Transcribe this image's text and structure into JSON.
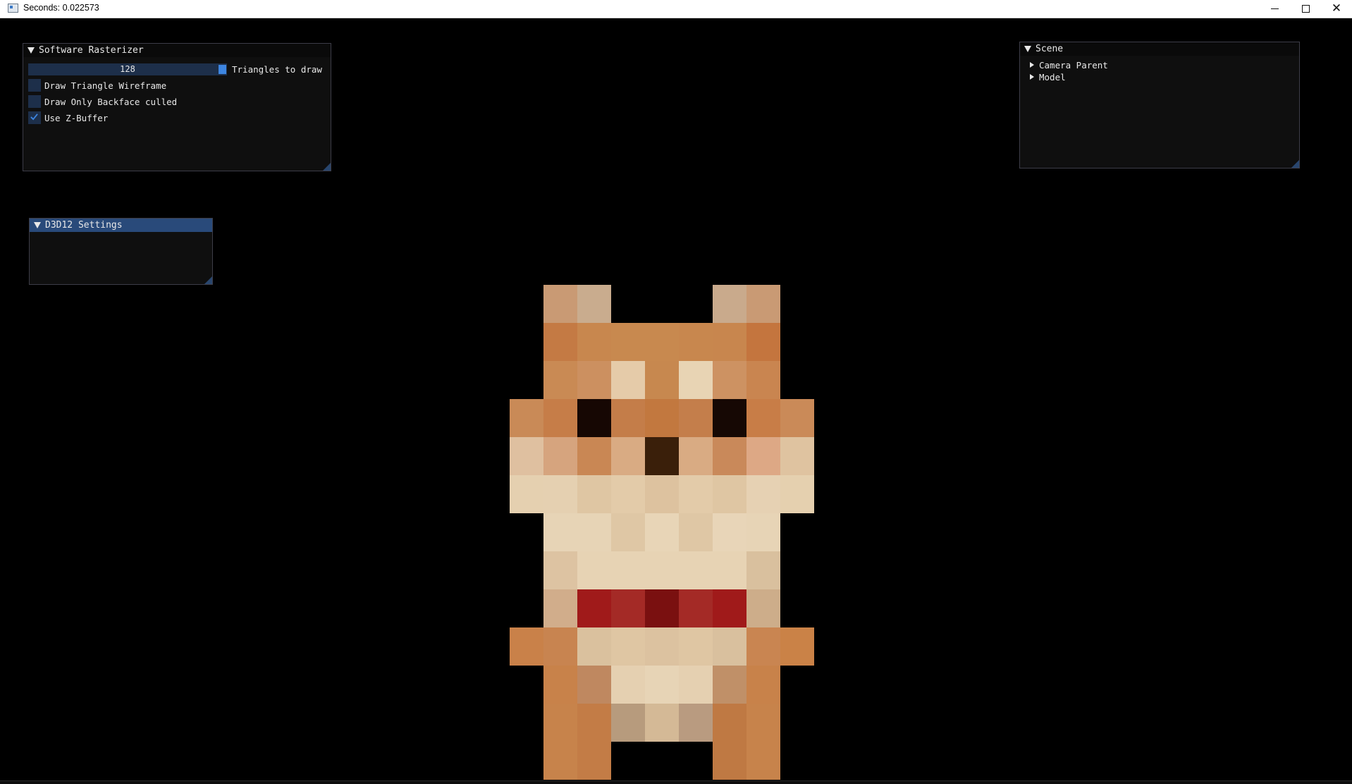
{
  "window": {
    "title": "Seconds: 0.022573",
    "minimize_label": "",
    "maximize_label": "",
    "close_label": "✕"
  },
  "rasterizer": {
    "title": "Software Rasterizer",
    "slider": {
      "value": "128",
      "label": "Triangles to draw"
    },
    "checkboxes": [
      {
        "label": "Draw Triangle Wireframe",
        "checked": false
      },
      {
        "label": "Draw Only Backface culled",
        "checked": false
      },
      {
        "label": "Use Z-Buffer",
        "checked": true
      }
    ]
  },
  "d3d12": {
    "title": "D3D12 Settings"
  },
  "scene": {
    "title": "Scene",
    "items": [
      {
        "label": "Camera Parent"
      },
      {
        "label": "Model"
      }
    ]
  },
  "colors": {
    "accent": "#3d85e0",
    "title_active": "#294a7a",
    "frame_bg": "#1d2f4a"
  },
  "model_pixels": [
    [
      null,
      null,
      null,
      null,
      null,
      null,
      null,
      null,
      null
    ],
    [
      null,
      "#c99a74",
      "#c9ac8e",
      null,
      null,
      null,
      "#c9aa8c",
      "#c99a74",
      null
    ],
    [
      null,
      "#c47a44",
      "#c8874e",
      "#c8894f",
      "#c8894f",
      "#c8874e",
      "#c8864e",
      "#c4753e",
      null
    ],
    [
      null,
      "#c98a54",
      "#cc9060",
      "#e5cba9",
      "#c7884f",
      "#e8d4b4",
      "#cd9262",
      "#c98550",
      null
    ],
    [
      "#c98a57",
      "#c67d48",
      "#160703",
      "#c47d49",
      "#c2783f",
      "#c47e4b",
      "#160804",
      "#c87d47",
      "#ca8a58"
    ],
    [
      "#dfc0a0",
      "#d6a47e",
      "#c98754",
      "#d9ab83",
      "#3a1f0a",
      "#d9ab83",
      "#c9895a",
      "#dda885",
      "#dfc3a0"
    ],
    [
      "#e5d0b0",
      "#e5d0b1",
      "#dfc6a3",
      "#e3cba9",
      "#ddc29f",
      "#e3cba9",
      "#dfc6a3",
      "#e6d1b3",
      "#e5d0af"
    ],
    [
      null,
      "#e7d4b6",
      "#e7d4b6",
      "#dfc7a5",
      "#e8d5b7",
      "#dfc7a5",
      "#e8d5b8",
      "#e7d4b6",
      null
    ],
    [
      null,
      "#ddc3a2",
      "#e7d3b4",
      "#e7d3b4",
      "#e7d3b4",
      "#e7d3b4",
      "#e7d3b4",
      "#d9c09e",
      null
    ],
    [
      null,
      "#d1ad8b",
      "#a01a1a",
      "#a42a26",
      "#7a1010",
      "#a42a26",
      "#a01a1a",
      "#cdad8a",
      null
    ],
    [
      "#c98149",
      "#c88450",
      "#dac19e",
      "#dfc6a3",
      "#dcc2a0",
      "#dfc6a3",
      "#d9c09e",
      "#c98551",
      "#ca8247"
    ],
    [
      null,
      "#c8824a",
      "#bf8860",
      "#e5d0b1",
      "#e7d4b6",
      "#e5d0b1",
      "#c09068",
      "#c8824a",
      null
    ],
    [
      null,
      "#c7834b",
      "#c37c46",
      "#b79b7d",
      "#d4b996",
      "#b99b80",
      "#bf7943",
      "#c7834b",
      null
    ],
    [
      null,
      "#c7834b",
      "#c37c46",
      null,
      null,
      null,
      "#bf7943",
      "#c7834b",
      null
    ]
  ]
}
